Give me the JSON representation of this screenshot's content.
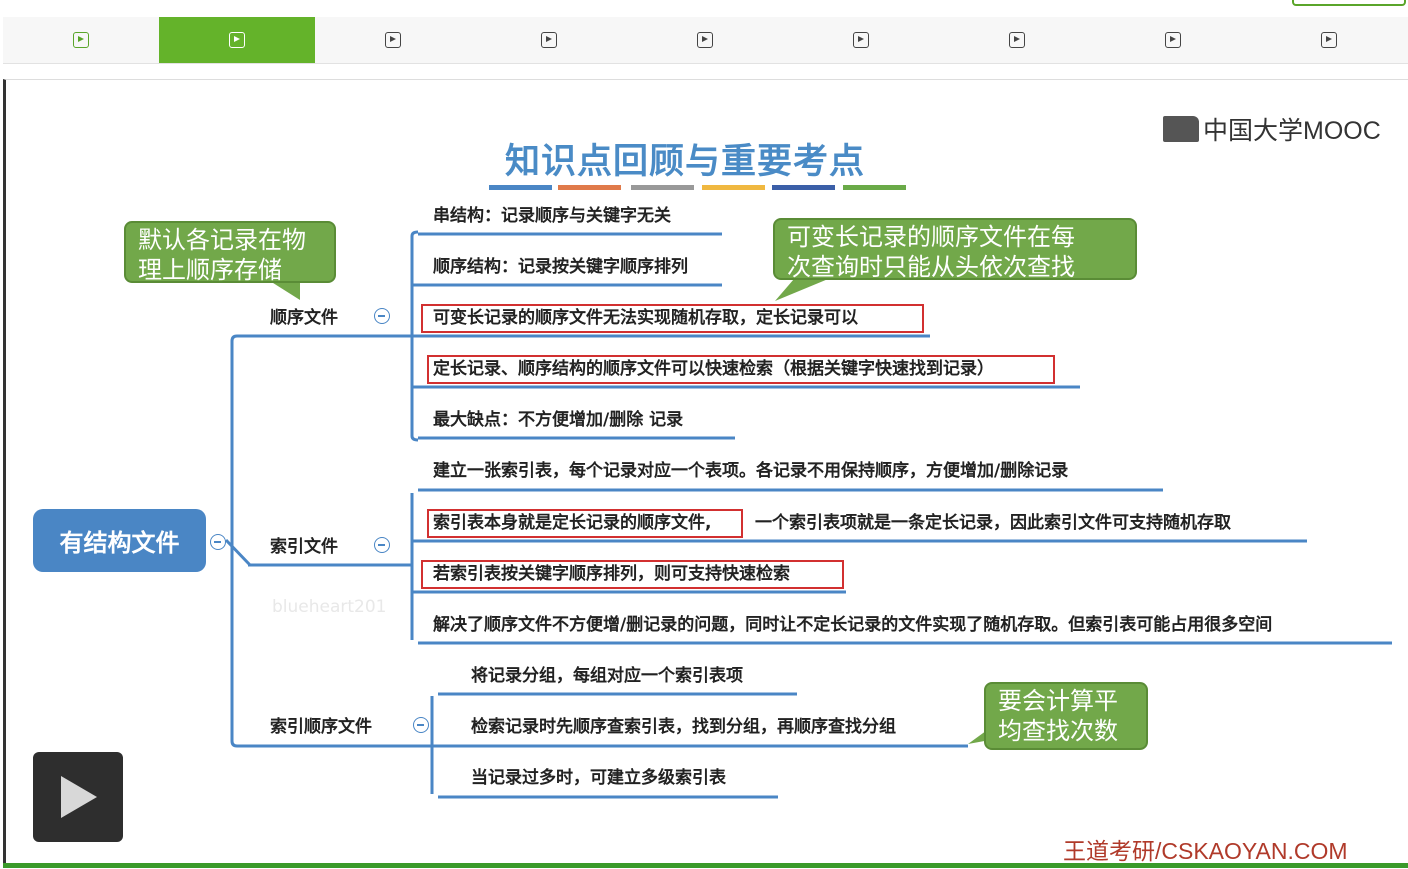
{
  "tabs": [
    {
      "name": "tab-1",
      "active": false
    },
    {
      "name": "tab-2",
      "active": true
    },
    {
      "name": "tab-3",
      "active": false
    },
    {
      "name": "tab-4",
      "active": false
    },
    {
      "name": "tab-5",
      "active": false
    },
    {
      "name": "tab-6",
      "active": false
    },
    {
      "name": "tab-7",
      "active": false
    },
    {
      "name": "tab-8",
      "active": false
    },
    {
      "name": "tab-9",
      "active": false
    }
  ],
  "slide": {
    "title": "知识点回顾与重要考点",
    "logo": "中国大学MOOC",
    "footer": "王道考研/CSKAOYAN.COM",
    "watermark": "blueheart201",
    "title_underline_colors": [
      "#4a86c5",
      "#e07a4a",
      "#999999",
      "#f0b840",
      "#3b5fa8",
      "#6aaa48"
    ],
    "root": "有结构文件",
    "branches": {
      "sequential": {
        "label": "顺序文件",
        "items": [
          "串结构：记录顺序与关键字无关",
          "顺序结构：记录按关键字顺序排列",
          "可变长记录的顺序文件无法实现随机存取，定长记录可以",
          "定长记录、顺序结构的顺序文件可以快速检索（根据关键字快速找到记录）",
          "最大缺点：不方便增加/删除 记录"
        ]
      },
      "index": {
        "label": "索引文件",
        "items": [
          "建立一张索引表，每个记录对应一个表项。各记录不用保持顺序，方便增加/删除记录",
          "索引表本身就是定长记录的顺序文件,",
          "一个索引表项就是一条定长记录，因此索引文件可支持随机存取",
          "若索引表按关键字顺序排列，则可支持快速检索",
          "解决了顺序文件不方便增/删记录的问题，同时让不定长记录的文件实现了随机存取。但索引表可能占用很多空间"
        ]
      },
      "indexed_sequential": {
        "label": "索引顺序文件",
        "items": [
          "将记录分组，每组对应一个索引表项",
          "检索记录时先顺序查索引表，找到分组，再顺序查找分组",
          "当记录过多时，可建立多级索引表"
        ]
      }
    },
    "callouts": {
      "physical_order": [
        "默认各记录在物",
        "理上顺序存储"
      ],
      "variable_length": [
        "可变长记录的顺序文件在每",
        "次查询时只能从头依次查找"
      ],
      "avg_search": [
        "要会计算平",
        "均查找次数"
      ]
    },
    "colors": {
      "accent": "#64b32a",
      "node": "#4a86c5",
      "callout": "#72a84a",
      "highlight": "#d23030",
      "footer": "#b03a2a"
    }
  },
  "player": {
    "icon": "play-icon"
  }
}
